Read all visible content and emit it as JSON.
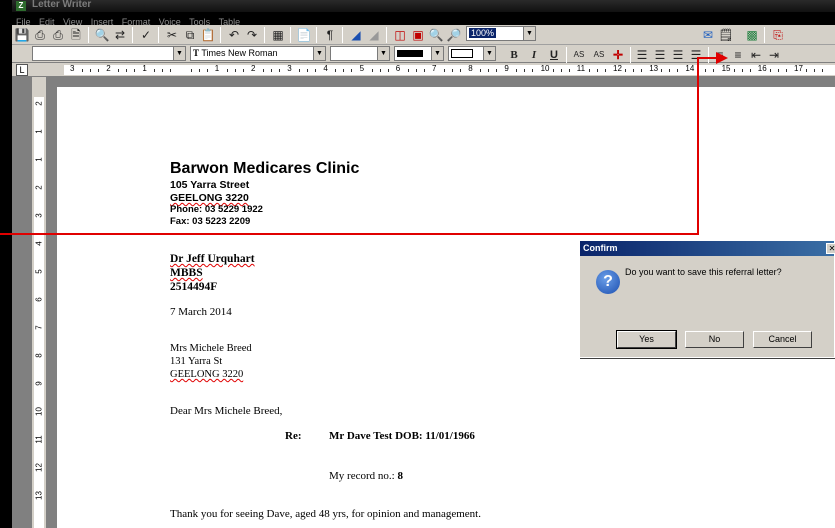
{
  "app": {
    "title": "Letter Writer",
    "icon_letter": "Z"
  },
  "menu": [
    "File",
    "Edit",
    "View",
    "Insert",
    "Format",
    "Voice",
    "Tools",
    "Table"
  ],
  "toolbar": {
    "zoom_value": "100%",
    "font_name": "Times New Roman",
    "bold_label": "B",
    "italic_label": "I",
    "underline_label": "U",
    "subscript_label": "AS",
    "superscript_label": "AS",
    "pilcrow": "¶"
  },
  "ruler": {
    "numbers": [
      "3",
      "2",
      "1",
      "",
      "1",
      "2",
      "3",
      "4",
      "5",
      "6",
      "7",
      "8",
      "9",
      "10",
      "11",
      "12",
      "13",
      "14",
      "15",
      "16",
      "17"
    ],
    "vertical_numbers": [
      "2",
      "1",
      "1",
      "2",
      "3",
      "4",
      "5",
      "6",
      "7",
      "8",
      "9",
      "10",
      "11",
      "12",
      "13"
    ]
  },
  "letter": {
    "clinic_name": "Barwon Medicares Clinic",
    "street": "105 Yarra Street",
    "city": "GEELONG  3220",
    "phone": "Phone: 03 5229 1922",
    "fax": "Fax: 03 5223 2209",
    "doctor_name": "Dr Jeff Urquhart",
    "doctor_quals": "MBBS",
    "doctor_number": "2514494F",
    "date": "7 March 2014",
    "recipient_name": "Mrs Michele Breed",
    "recipient_street": "131 Yarra St",
    "recipient_city": "GEELONG 3220",
    "salutation": "Dear Mrs Michele Breed,",
    "re_label": "Re:",
    "re_text": "Mr Dave Test  DOB: 11/01/1966",
    "record_label": "My record no.: ",
    "record_value": "8",
    "body_text": "Thank you for seeing Dave, aged 48 yrs, for opinion and management."
  },
  "dialog": {
    "title": "Confirm",
    "message": "Do you want to save this referral letter?",
    "yes": "Yes",
    "no": "No",
    "cancel": "Cancel"
  },
  "colors": {
    "annotation_red": "#e00000",
    "dialog_title_blue": "#0a246a",
    "toolbar_gray": "#d4d0c8"
  }
}
